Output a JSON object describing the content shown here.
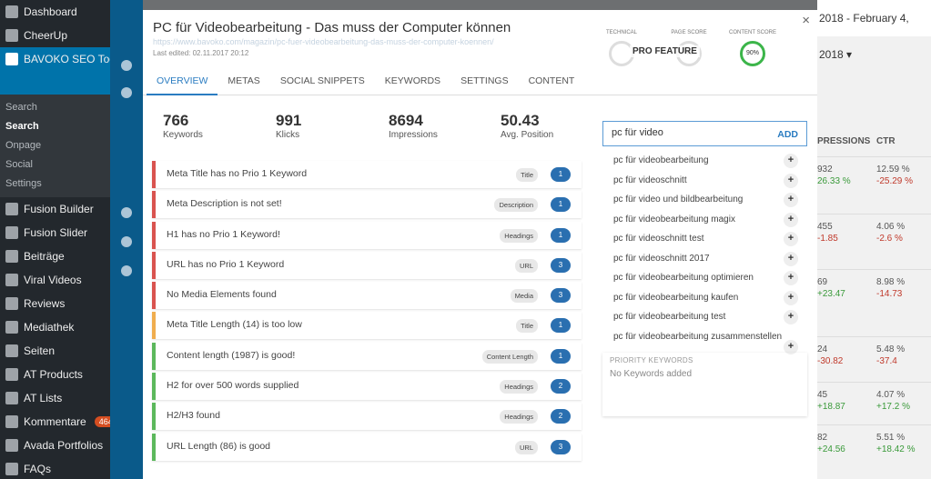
{
  "sidebar": {
    "items": [
      {
        "label": "Dashboard",
        "icon": "dashboard-icon"
      },
      {
        "label": "CheerUp",
        "icon": "brush-icon"
      },
      {
        "label": "BAVOKO SEO Tools",
        "icon": "gear-icon",
        "active": true
      },
      {
        "label": "Fusion Builder",
        "icon": "fusion-icon"
      },
      {
        "label": "Fusion Slider",
        "icon": "fusion-icon"
      },
      {
        "label": "Beiträge",
        "icon": "pin-icon"
      },
      {
        "label": "Viral Videos",
        "icon": "pin-icon"
      },
      {
        "label": "Reviews",
        "icon": "star-icon"
      },
      {
        "label": "Mediathek",
        "icon": "media-icon"
      },
      {
        "label": "Seiten",
        "icon": "page-icon"
      },
      {
        "label": "AT Products",
        "icon": "pin-icon"
      },
      {
        "label": "AT Lists",
        "icon": "pin-icon"
      },
      {
        "label": "Kommentare",
        "icon": "comment-icon",
        "badge": "464"
      },
      {
        "label": "Avada Portfolios",
        "icon": "portfolio-icon"
      },
      {
        "label": "FAQs",
        "icon": "faq-icon"
      }
    ],
    "submenu": [
      "Search",
      "Search",
      "Onpage",
      "Social",
      "Settings"
    ]
  },
  "background": {
    "date_range": "2018 - February 4, 2018 ▾",
    "col_impressions": "PRESSIONS",
    "col_ctr": "CTR",
    "rows": [
      {
        "imp": "932",
        "imp_delta": "26.33 %",
        "ctr": "12.59 %",
        "ctr_delta": "-25.29 %"
      },
      {
        "imp": "455",
        "imp_delta": "-1.85",
        "ctr": "4.06 %",
        "ctr_delta": "-2.6 %"
      },
      {
        "imp": "69",
        "imp_delta": "+23.47",
        "ctr": "8.98 %",
        "ctr_delta": "-14.73"
      },
      {
        "imp": "24",
        "imp_delta": "-30.82",
        "ctr": "5.48 %",
        "ctr_delta": "-37.4"
      },
      {
        "imp": "45",
        "imp_delta": "+18.87",
        "ctr": "4.07 %",
        "ctr_delta": "+17.2 %"
      },
      {
        "imp": "82",
        "imp_delta": "+24.56",
        "ctr": "5.51 %",
        "ctr_delta": "+18.42 %"
      }
    ]
  },
  "modal": {
    "title": "PC für Videobearbeitung - Das muss der Computer können",
    "url": "https://www.bavoko.com/magazin/pc-fuer-videobearbeitung-das-muss-der-computer-koennen/",
    "edited": "Last edited: 02.11.2017 20:12",
    "close": "×",
    "scores": [
      {
        "label": "TECHNICAL",
        "value": "",
        "color": "#dddddd"
      },
      {
        "label": "PAGE SCORE",
        "value": "%",
        "color": "#dddddd"
      },
      {
        "label": "CONTENT SCORE",
        "value": "90%",
        "color": "#3cb54a"
      }
    ],
    "pro_feature": "PRO FEATURE",
    "tabs": [
      "OVERVIEW",
      "METAS",
      "SOCIAL SNIPPETS",
      "KEYWORDS",
      "SETTINGS",
      "CONTENT"
    ],
    "stats": [
      {
        "value": "766",
        "label": "Keywords"
      },
      {
        "value": "991",
        "label": "Klicks"
      },
      {
        "value": "8694",
        "label": "Impressions"
      },
      {
        "value": "50.43",
        "label": "Avg. Position"
      }
    ],
    "issues": [
      {
        "text": "Meta Title has no Prio 1 Keyword",
        "tag": "Title",
        "count": "1",
        "status": "red"
      },
      {
        "text": "Meta Description is not set!",
        "tag": "Description",
        "count": "1",
        "status": "red"
      },
      {
        "text": "H1 has no Prio 1 Keyword!",
        "tag": "Headings",
        "count": "1",
        "status": "red"
      },
      {
        "text": "URL has no Prio 1 Keyword",
        "tag": "URL",
        "count": "3",
        "status": "red"
      },
      {
        "text": "No Media Elements found",
        "tag": "Media",
        "count": "3",
        "status": "red"
      },
      {
        "text": "Meta Title Length (14) is too low",
        "tag": "Title",
        "count": "1",
        "status": "orange"
      },
      {
        "text": "Content length (1987) is good!",
        "tag": "Content Length",
        "count": "1",
        "status": "green"
      },
      {
        "text": "H2 for over 500 words supplied",
        "tag": "Headings",
        "count": "2",
        "status": "green"
      },
      {
        "text": "H2/H3 found",
        "tag": "Headings",
        "count": "2",
        "status": "green"
      },
      {
        "text": "URL Length (86) is good",
        "tag": "URL",
        "count": "3",
        "status": "green"
      }
    ],
    "keyword_input": {
      "value": "pc für video",
      "add_label": "ADD"
    },
    "suggestions": [
      "pc für videobearbeitung",
      "pc für videoschnitt",
      "pc für video und bildbearbeitung",
      "pc für videobearbeitung magix",
      "pc für videoschnitt test",
      "pc für videoschnitt 2017",
      "pc für videobearbeitung optimieren",
      "pc für videobearbeitung kaufen",
      "pc für videobearbeitung test",
      "pc für videobearbeitung zusammenstellen"
    ],
    "priority": {
      "heading": "PRIORITY KEYWORDS",
      "empty": "No Keywords added"
    }
  }
}
